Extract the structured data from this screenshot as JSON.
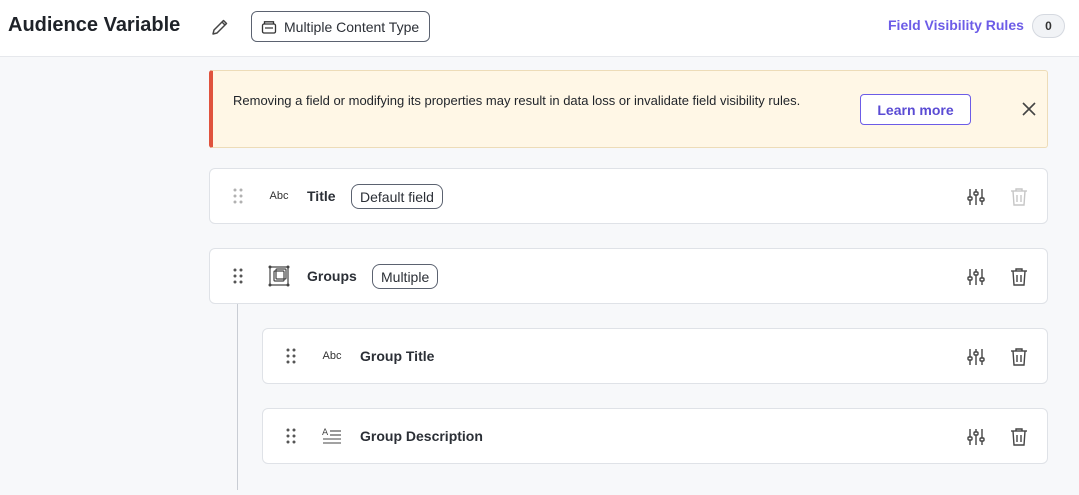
{
  "header": {
    "title": "Audience Variable",
    "content_type_label": "Multiple Content Type",
    "field_visibility_label": "Field Visibility Rules",
    "field_visibility_count": "0"
  },
  "alert": {
    "message": "Removing a field or modifying its properties may result in data loss or invalidate field visibility rules.",
    "learn_more_label": "Learn more",
    "accent_color": "#e0533d"
  },
  "fields": [
    {
      "name": "Title",
      "type_icon": "text-abc-icon",
      "type_label": "Abc",
      "tag": "Default field",
      "delete_disabled": true
    },
    {
      "name": "Groups",
      "type_icon": "group-icon",
      "tag": "Multiple",
      "delete_disabled": false
    },
    {
      "name": "Group Title",
      "type_icon": "text-abc-icon",
      "type_label": "Abc",
      "delete_disabled": false
    },
    {
      "name": "Group Description",
      "type_icon": "multiline-text-icon",
      "delete_disabled": false
    }
  ]
}
